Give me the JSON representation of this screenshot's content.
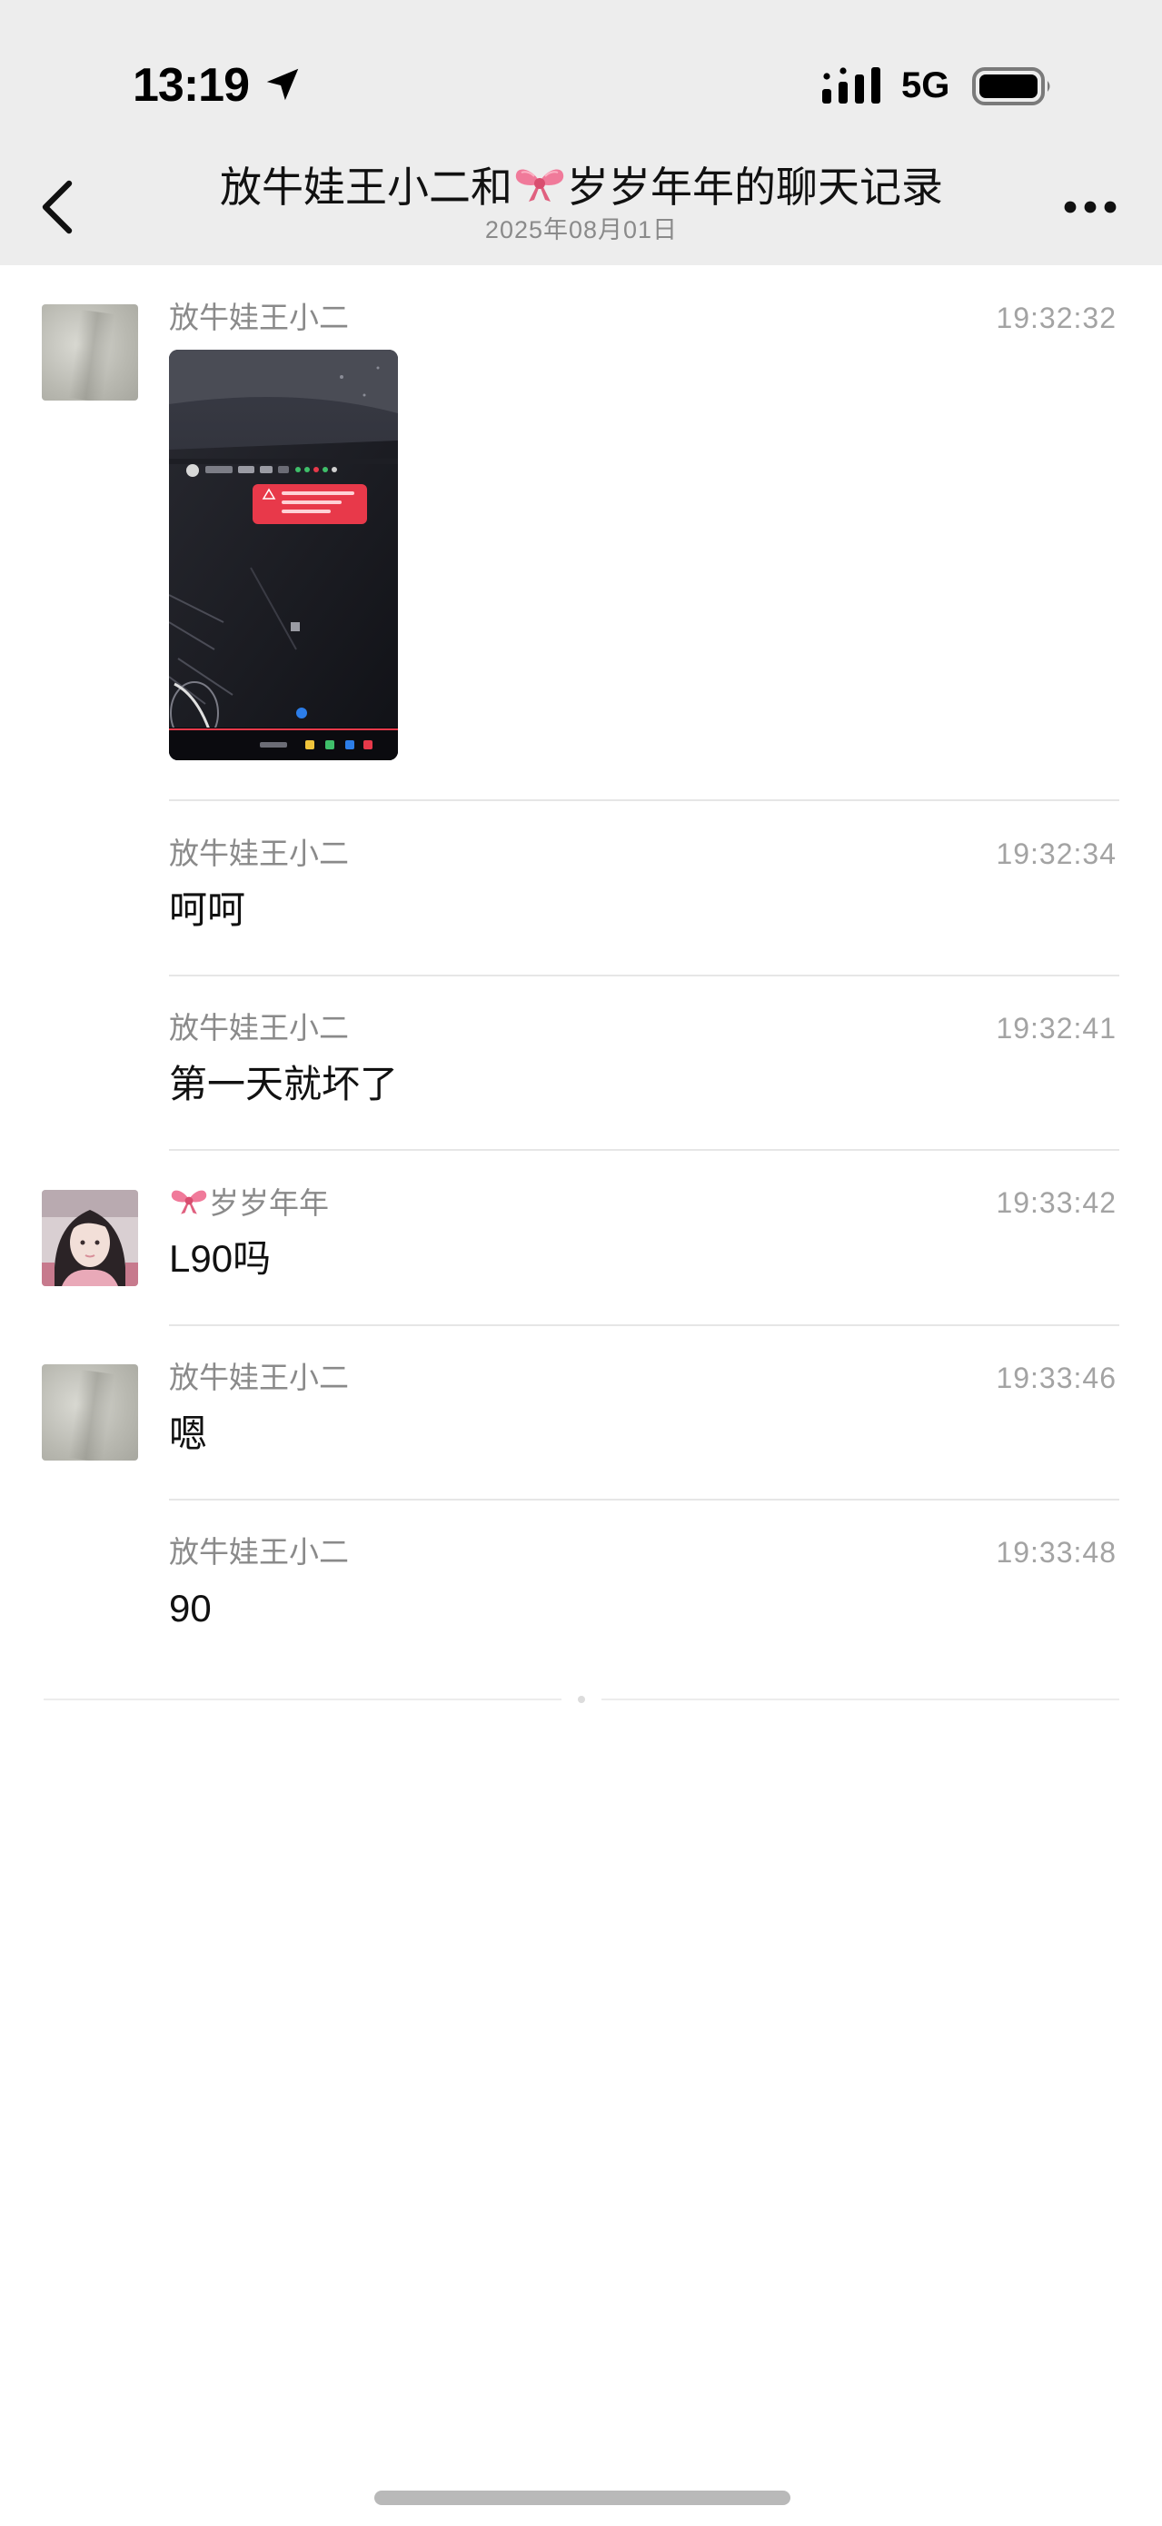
{
  "status_bar": {
    "time": "13:19",
    "network": "5G",
    "icons": [
      "location-arrow-icon",
      "signal-icon",
      "battery-icon"
    ]
  },
  "header": {
    "back_icon": "chevron-left-icon",
    "title_left": "放牛娃王小二和",
    "title_emoji": "ribbon-bow-emoji",
    "title_right": "岁岁年年的聊天记录",
    "date": "2025年08月01日",
    "more_icon": "more-dots-icon"
  },
  "messages": [
    {
      "sender": "放牛娃王小二",
      "time": "19:32:32",
      "type": "image",
      "avatar": "gray-avatar",
      "image_desc": "car-screen-photo"
    },
    {
      "sender": "放牛娃王小二",
      "time": "19:32:34",
      "type": "text",
      "text": "呵呵"
    },
    {
      "sender": "放牛娃王小二",
      "time": "19:32:41",
      "type": "text",
      "text": "第一天就坏了"
    },
    {
      "sender": "岁岁年年",
      "sender_emoji": "ribbon-bow-emoji",
      "time": "19:33:42",
      "type": "text",
      "text": "L90吗",
      "avatar": "girl-avatar"
    },
    {
      "sender": "放牛娃王小二",
      "time": "19:33:46",
      "type": "text",
      "text": "嗯",
      "avatar": "gray-avatar"
    },
    {
      "sender": "放牛娃王小二",
      "time": "19:33:48",
      "type": "text",
      "text": "90"
    }
  ],
  "colors": {
    "header_bg": "#ededed",
    "page_bg": "#ffffff",
    "meta_text": "#8a8a8a",
    "divider": "#e6e6e6",
    "alert_red": "#e8394a",
    "bow_pink": "#f07a9a"
  }
}
